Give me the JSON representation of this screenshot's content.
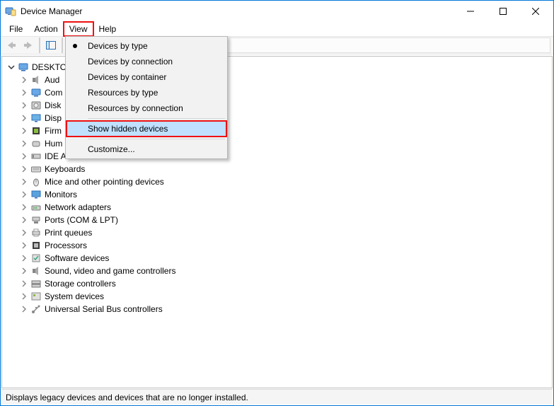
{
  "window": {
    "title": "Device Manager"
  },
  "menubar": {
    "items": [
      "File",
      "Action",
      "View",
      "Help"
    ],
    "open_index": 2
  },
  "dropdown": {
    "groups": [
      {
        "items": [
          {
            "label": "Devices by type",
            "checked": true
          },
          {
            "label": "Devices by connection",
            "checked": false
          },
          {
            "label": "Devices by container",
            "checked": false
          },
          {
            "label": "Resources by type",
            "checked": false
          },
          {
            "label": "Resources by connection",
            "checked": false
          }
        ]
      },
      {
        "items": [
          {
            "label": "Show hidden devices",
            "highlighted": true
          }
        ]
      },
      {
        "items": [
          {
            "label": "Customize..."
          }
        ]
      }
    ]
  },
  "tree": {
    "root": {
      "label": "DESKTO",
      "expanded": true
    },
    "children": [
      {
        "label": "Aud",
        "icon": "speaker"
      },
      {
        "label": "Com",
        "icon": "computer"
      },
      {
        "label": "Disk",
        "icon": "disk"
      },
      {
        "label": "Disp",
        "icon": "display"
      },
      {
        "label": "Firm",
        "icon": "chip"
      },
      {
        "label": "Hum",
        "icon": "hid"
      },
      {
        "label": "IDE A",
        "icon": "ide"
      },
      {
        "label": "Keyboards",
        "icon": "keyboard"
      },
      {
        "label": "Mice and other pointing devices",
        "icon": "mouse"
      },
      {
        "label": "Monitors",
        "icon": "monitor"
      },
      {
        "label": "Network adapters",
        "icon": "network"
      },
      {
        "label": "Ports (COM & LPT)",
        "icon": "port"
      },
      {
        "label": "Print queues",
        "icon": "printer"
      },
      {
        "label": "Processors",
        "icon": "cpu"
      },
      {
        "label": "Software devices",
        "icon": "software"
      },
      {
        "label": "Sound, video and game controllers",
        "icon": "speaker"
      },
      {
        "label": "Storage controllers",
        "icon": "storage"
      },
      {
        "label": "System devices",
        "icon": "system"
      },
      {
        "label": "Universal Serial Bus controllers",
        "icon": "usb"
      }
    ]
  },
  "statusbar": {
    "text": "Displays legacy devices and devices that are no longer installed."
  }
}
